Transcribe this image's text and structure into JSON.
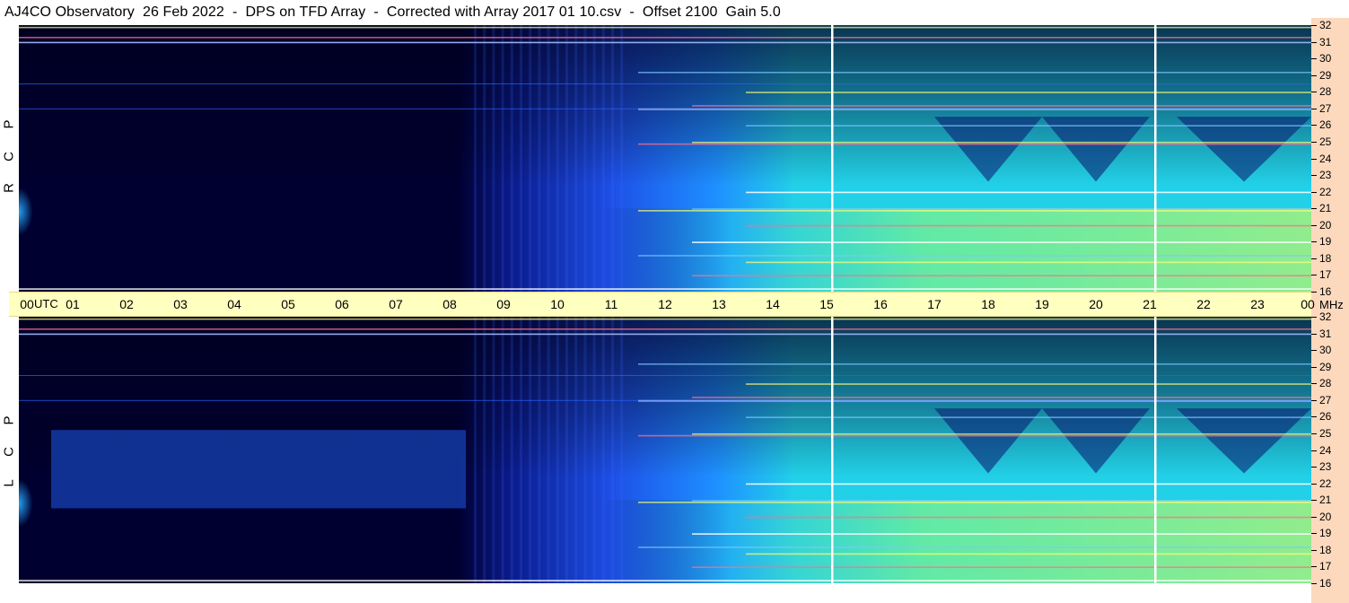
{
  "title": "AJ4CO Observatory  26 Feb 2022  -  DPS on TFD Array  -  Corrected with Array 2017 01 10.csv  -  Offset 2100  Gain 5.0",
  "panels": [
    {
      "id": "top",
      "side_label": [
        "R",
        "C",
        "P"
      ]
    },
    {
      "id": "bottom",
      "side_label": [
        "L",
        "C",
        "P"
      ]
    }
  ],
  "chart_data": [
    {
      "type": "heatmap",
      "title": "AJ4CO Observatory  26 Feb 2022  -  DPS on TFD Array  -  Corrected with Array 2017 01 10.csv  -  Offset 2100  Gain 5.0",
      "panel": "RCP",
      "x_unit": "UTC",
      "y_unit": "MHz",
      "xlim": [
        0,
        24
      ],
      "ylim": [
        16,
        32
      ],
      "x_ticks": [
        "00",
        "01",
        "02",
        "03",
        "04",
        "05",
        "06",
        "07",
        "08",
        "09",
        "10",
        "11",
        "12",
        "13",
        "14",
        "15",
        "16",
        "17",
        "18",
        "19",
        "20",
        "21",
        "22",
        "23",
        "00"
      ],
      "y_ticks": [
        "16",
        "17",
        "18",
        "19",
        "20",
        "21",
        "22",
        "23",
        "24",
        "25",
        "26",
        "27",
        "28",
        "29",
        "30",
        "31",
        "32"
      ],
      "colormap": [
        "#000030",
        "#0a1a8a",
        "#1e50e8",
        "#1e90ff",
        "#22d0e8",
        "#80ff80",
        "#ffff40",
        "#ff7070",
        "#ffffff"
      ],
      "markers_utc": [
        15.1,
        21.1
      ]
    },
    {
      "type": "heatmap",
      "panel": "LCP",
      "x_unit": "UTC",
      "y_unit": "MHz",
      "xlim": [
        0,
        24
      ],
      "ylim": [
        16,
        32
      ],
      "x_ticks": [
        "00",
        "01",
        "02",
        "03",
        "04",
        "05",
        "06",
        "07",
        "08",
        "09",
        "10",
        "11",
        "12",
        "13",
        "14",
        "15",
        "16",
        "17",
        "18",
        "19",
        "20",
        "21",
        "22",
        "23",
        "00"
      ],
      "y_ticks": [
        "16",
        "17",
        "18",
        "19",
        "20",
        "21",
        "22",
        "23",
        "24",
        "25",
        "26",
        "27",
        "28",
        "29",
        "30",
        "31",
        "32"
      ],
      "colormap": [
        "#000030",
        "#0a1a8a",
        "#1e50e8",
        "#1e90ff",
        "#22d0e8",
        "#80ff80",
        "#ffff40",
        "#ff7070",
        "#ffffff"
      ],
      "markers_utc": [
        15.1,
        21.1
      ]
    }
  ],
  "axis": {
    "time_labels": [
      "00",
      "01",
      "02",
      "03",
      "04",
      "05",
      "06",
      "07",
      "08",
      "09",
      "10",
      "11",
      "12",
      "13",
      "14",
      "15",
      "16",
      "17",
      "18",
      "19",
      "20",
      "21",
      "22",
      "23",
      "00"
    ],
    "utc_label": "UTC",
    "mhz_label": "MHz",
    "freq_labels": [
      "16",
      "17",
      "18",
      "19",
      "20",
      "21",
      "22",
      "23",
      "24",
      "25",
      "26",
      "27",
      "28",
      "29",
      "30",
      "31",
      "32"
    ]
  }
}
